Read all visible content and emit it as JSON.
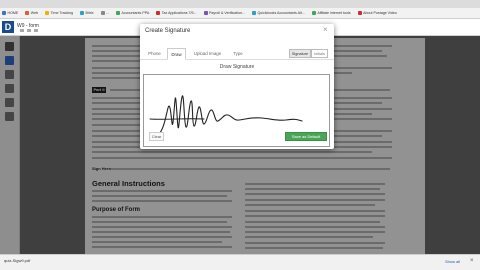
{
  "browser": {
    "bookmarks": [
      {
        "label": "HOME",
        "color": "#3b6fd4"
      },
      {
        "label": "Web",
        "color": "#e25a2a"
      },
      {
        "label": "Time Tracking",
        "color": "#f0b000"
      },
      {
        "label": "Bitrix",
        "color": "#2a9fd6"
      },
      {
        "label": "...",
        "color": "#888888"
      },
      {
        "label": "Accountants PPA",
        "color": "#3aa860"
      },
      {
        "label": "Tax Applications 7/9...",
        "color": "#c9302c"
      },
      {
        "label": "Payroll & Verification...",
        "color": "#7a4fbf"
      },
      {
        "label": "Quickbooks Accountants Alt...",
        "color": "#2a9fd6"
      },
      {
        "label": "Affiliate internet tools",
        "color": "#3aa860"
      },
      {
        "label": "About Postage Video",
        "color": "#c9302c"
      }
    ]
  },
  "app": {
    "logo_text": "D",
    "doc_title": "W9 - form"
  },
  "document": {
    "part_label": "Part II",
    "sign_label": "Sign Here",
    "general_heading": "General Instructions",
    "purpose_heading": "Purpose of Form"
  },
  "modal": {
    "title": "Create Signature",
    "close_glyph": "×",
    "tabs": [
      {
        "label": "Phone",
        "active": false
      },
      {
        "label": "Draw",
        "active": true
      },
      {
        "label": "Upload Image",
        "active": false
      },
      {
        "label": "Type",
        "active": false
      }
    ],
    "segments": [
      {
        "label": "Signature",
        "active": true
      },
      {
        "label": "Initials",
        "active": false
      }
    ],
    "draw_title": "Draw Signature",
    "clear_label": "Clear",
    "save_label": "Save as Default"
  },
  "download_bar": {
    "file_label": "quiz-Sigw9.pdf",
    "show_all_label": "Show all",
    "close_glyph": "×"
  }
}
